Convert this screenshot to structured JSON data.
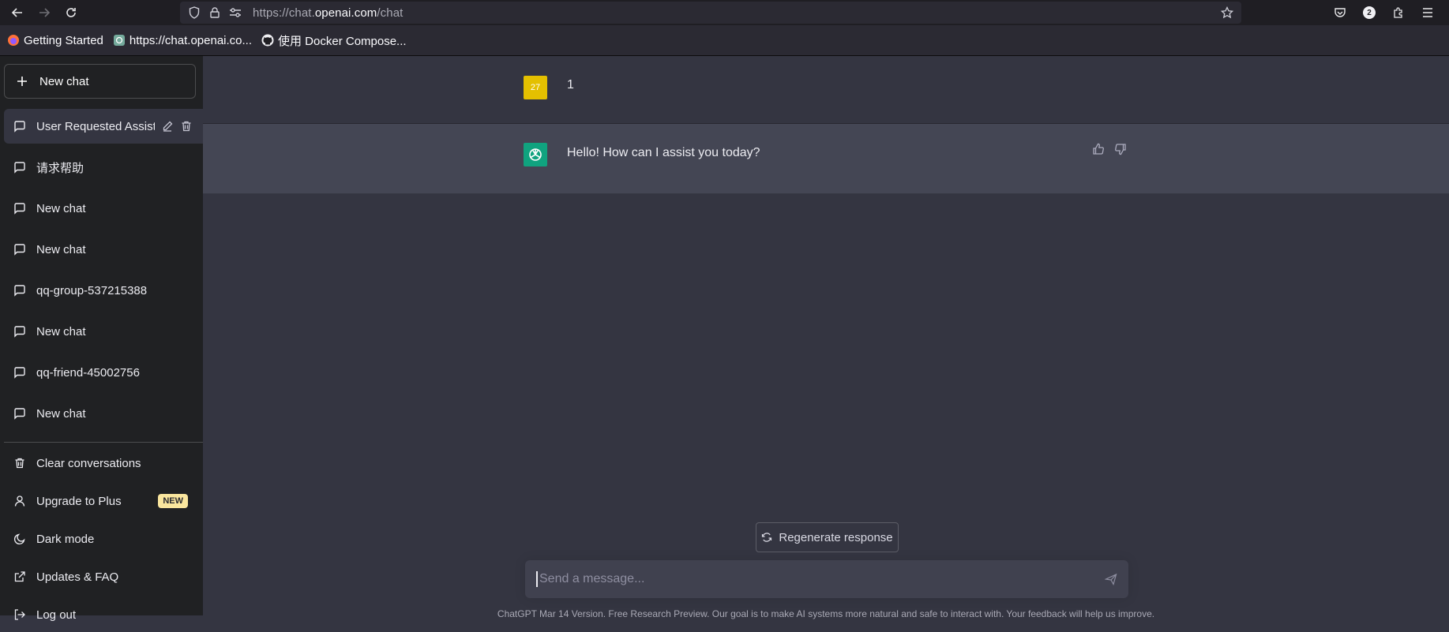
{
  "browser": {
    "url_prefix": "https://chat.",
    "url_domain": "openai.com",
    "url_suffix": "/chat",
    "extension_badge": "2",
    "bookmarks": [
      "Getting Started",
      "https://chat.openai.co...",
      "使用 Docker Compose..."
    ]
  },
  "sidebar": {
    "new_chat_label": "New chat",
    "conversations": [
      {
        "label": "User Requested Assista"
      },
      {
        "label": "请求帮助"
      },
      {
        "label": "New chat"
      },
      {
        "label": "New chat"
      },
      {
        "label": "qq-group-537215388"
      },
      {
        "label": "New chat"
      },
      {
        "label": "qq-friend-45002756"
      },
      {
        "label": "New chat"
      }
    ],
    "menu": {
      "clear": "Clear conversations",
      "upgrade": "Upgrade to Plus",
      "new_badge": "NEW",
      "dark_mode": "Dark mode",
      "updates": "Updates & FAQ",
      "logout": "Log out"
    }
  },
  "chat": {
    "user_avatar_text": "27",
    "user_message": "1",
    "assistant_message": "Hello! How can I assist you today?",
    "regenerate_label": "Regenerate response",
    "input_placeholder": "Send a message...",
    "footer": "ChatGPT Mar 14 Version. Free Research Preview. Our goal is to make AI systems more natural and safe to interact with. Your feedback will help us improve."
  },
  "colors": {
    "sidebar_bg": "#202123",
    "main_bg": "#343541",
    "assistant_bg": "#444654",
    "accent_green": "#10a37f",
    "user_avatar": "#e4c000",
    "new_badge": "#fae69e"
  }
}
